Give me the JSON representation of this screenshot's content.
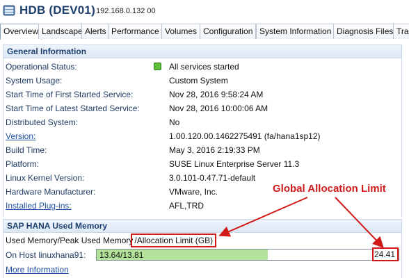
{
  "header": {
    "title": "HDB (DEV01)",
    "host_ip": "192.168.0.132 00",
    "icon": "database-icon"
  },
  "tabs": [
    {
      "label": "Overview",
      "active": true
    },
    {
      "label": "Landscape",
      "active": false
    },
    {
      "label": "Alerts",
      "active": false
    },
    {
      "label": "Performance",
      "active": false
    },
    {
      "label": "Volumes",
      "active": false
    },
    {
      "label": "Configuration",
      "active": false
    },
    {
      "label": "System Information",
      "active": false
    },
    {
      "label": "Diagnosis Files",
      "active": false
    },
    {
      "label": "Trac",
      "active": false
    }
  ],
  "general": {
    "title": "General Information",
    "rows": [
      {
        "label": "Operational Status:",
        "value": "All services started",
        "link": false,
        "status_color": "#5fbf3a"
      },
      {
        "label": "System Usage:",
        "value": "Custom System",
        "link": false
      },
      {
        "label": "Start Time of First Started Service:",
        "value": "Nov 28, 2016 9:58:24 AM",
        "link": false
      },
      {
        "label": "Start Time of Latest Started Service:",
        "value": "Nov 28, 2016 10:00:06 AM",
        "link": false
      },
      {
        "label": "Distributed System:",
        "value": "No",
        "link": false
      },
      {
        "label": "Version:",
        "value": "1.00.120.00.1462275491 (fa/hana1sp12)",
        "link": true
      },
      {
        "label": "Build Time:",
        "value": "May 3, 2016 2:19:33 PM",
        "link": false
      },
      {
        "label": "Platform:",
        "value": "SUSE Linux Enterprise Server 11.3",
        "link": false
      },
      {
        "label": "Linux Kernel Version:",
        "value": "3.0.101-0.47.71-default",
        "link": false
      },
      {
        "label": "Hardware Manufacturer:",
        "value": "VMware, Inc.",
        "link": false
      },
      {
        "label": "Installed Plug-ins:",
        "value": "AFL,TRD",
        "link": true
      }
    ]
  },
  "memory": {
    "title": "SAP HANA Used Memory",
    "caption_prefix": "Used Memory/Peak Used Memory",
    "caption_boxed": "/Allocation Limit (GB)",
    "host_label": "On Host linuxhana91:",
    "bar_text": "13.64/13.81",
    "used_fraction": 0.566,
    "limit": "24.41",
    "more_info": "More Information"
  },
  "annotation": {
    "text": "Global Allocation Limit",
    "color": "#d01a1a"
  }
}
